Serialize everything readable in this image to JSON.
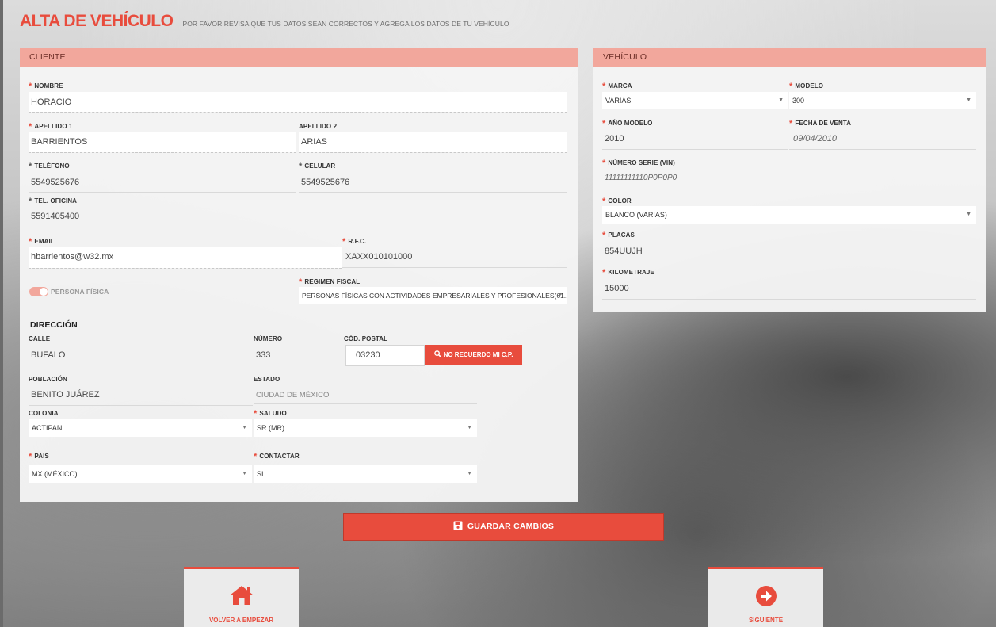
{
  "header": {
    "title": "ALTA DE VEHÍCULO",
    "subtitle": "POR FAVOR REVISA QUE TUS DATOS SEAN CORRECTOS Y AGREGA LOS DATOS DE TU VEHÍCULO"
  },
  "cliente": {
    "section_title": "CLIENTE",
    "nombre": {
      "label": "NOMBRE",
      "value": "HORACIO"
    },
    "apellido1": {
      "label": "APELLIDO 1",
      "value": "BARRIENTOS"
    },
    "apellido2": {
      "label": "APELLIDO 2",
      "value": "ARIAS"
    },
    "telefono": {
      "label": "TELÉFONO",
      "value": "5549525676"
    },
    "celular": {
      "label": "CELULAR",
      "value": "5549525676"
    },
    "tel_oficina": {
      "label": "TEL. OFICINA",
      "value": "5591405400"
    },
    "email": {
      "label": "EMAIL",
      "value": "hbarrientos@w32.mx"
    },
    "rfc": {
      "label": "R.F.C.",
      "value": "XAXX010101000"
    },
    "persona_fisica": {
      "label": "PERSONA FÍSICA"
    },
    "regimen_fiscal": {
      "label": "REGIMEN FISCAL",
      "value": "PERSONAS FÍSICAS CON ACTIVIDADES EMPRESARIALES Y PROFESIONALES(61..."
    },
    "direccion": {
      "title": "DIRECCIÓN",
      "calle": {
        "label": "CALLE",
        "value": "BUFALO"
      },
      "numero": {
        "label": "NÚMERO",
        "value": "333"
      },
      "cp": {
        "label": "CÓD. POSTAL",
        "value": "03230"
      },
      "cp_button": "NO RECUERDO MI C.P.",
      "poblacion": {
        "label": "POBLACIÓN",
        "value": "BENITO JUÁREZ"
      },
      "estado": {
        "label": "ESTADO",
        "value": "CIUDAD DE MÉXICO"
      },
      "colonia": {
        "label": "COLONIA",
        "value": "ACTIPAN"
      },
      "saludo": {
        "label": "SALUDO",
        "value": "SR (MR)"
      },
      "pais": {
        "label": "PAIS",
        "value": "MX (MÉXICO)"
      },
      "contactar": {
        "label": "CONTACTAR",
        "value": "SI"
      }
    }
  },
  "vehiculo": {
    "section_title": "VEHÍCULO",
    "marca": {
      "label": "MARCA",
      "value": "VARIAS"
    },
    "modelo": {
      "label": "MODELO",
      "value": "300"
    },
    "anio_modelo": {
      "label": "AÑO MODELO",
      "value": "2010"
    },
    "fecha_venta": {
      "label": "FECHA DE VENTA",
      "value": "09/04/2010"
    },
    "vin": {
      "label": "NÚMERO SERIE (VIN)",
      "value": "11111111110P0P0P0"
    },
    "color": {
      "label": "COLOR",
      "value": "BLANCO (VARIAS)"
    },
    "placas": {
      "label": "PLACAS",
      "value": "854UUJH"
    },
    "kilometraje": {
      "label": "KILOMETRAJE",
      "value": "15000"
    }
  },
  "actions": {
    "save": "GUARDAR CAMBIOS",
    "restart": "VOLVER A EMPEZAR",
    "next": "SIGUIENTE"
  },
  "colors": {
    "accent": "#e84c3d",
    "section_header": "#f2a79c"
  },
  "icons": {
    "save": "floppy-disk-icon",
    "search": "search-icon",
    "home": "home-icon",
    "next": "arrow-circle-right-icon"
  }
}
